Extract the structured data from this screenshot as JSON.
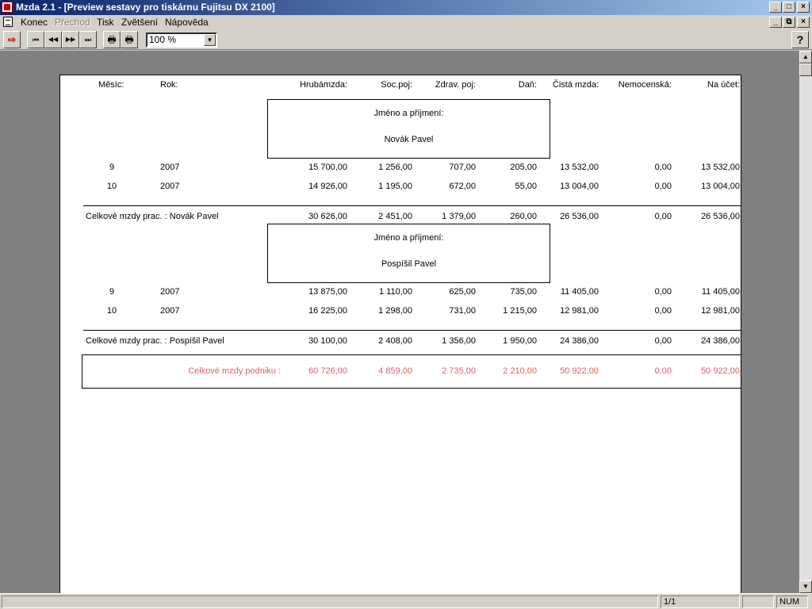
{
  "window": {
    "title": "Mzda 2.1 - [Preview sestavy pro tiskárnu Fujitsu DX 2100]",
    "btn_minimize": "_",
    "btn_maximize": "□",
    "btn_close": "×",
    "btn_restore": "⧉"
  },
  "menu": {
    "items": [
      "Konec",
      "Přechod",
      "Tisk",
      "Zvětšení",
      "Nápověda"
    ]
  },
  "toolbar": {
    "exit_glyph": "⇨",
    "first_glyph": "⏮",
    "prev_glyph": "◀◀",
    "next_glyph": "▶▶",
    "last_glyph": "⏭",
    "print_glyph": "🖶",
    "print_setup_glyph": "🖶",
    "help_glyph": "?",
    "zoom_value": "100 %",
    "dropdown_glyph": "▼"
  },
  "report": {
    "headers": [
      "Měsíc:",
      "Rok:",
      "Hrubámzda:",
      "Soc.poj:",
      "Zdrav. poj:",
      "Daň:",
      "Čistá mzda:",
      "Nemocenská:",
      "Na účet:"
    ],
    "name_label": "Jméno a příjmení:",
    "employees": [
      {
        "name": "Novák Pavel",
        "rows": [
          [
            "9",
            "2007",
            "15 700,00",
            "1 256,00",
            "707,00",
            "205,00",
            "13 532,00",
            "0,00",
            "13 532,00"
          ],
          [
            "10",
            "2007",
            "14 926,00",
            "1 195,00",
            "672,00",
            "55,00",
            "13 004,00",
            "0,00",
            "13 004,00"
          ]
        ],
        "total_label": "Celkové mzdy prac. : Novák Pavel",
        "totals": [
          "30 626,00",
          "2 451,00",
          "1 379,00",
          "260,00",
          "26 536,00",
          "0,00",
          "26 536,00"
        ]
      },
      {
        "name": "Pospíšil Pavel",
        "rows": [
          [
            "9",
            "2007",
            "13 875,00",
            "1 110,00",
            "625,00",
            "735,00",
            "11 405,00",
            "0,00",
            "11 405,00"
          ],
          [
            "10",
            "2007",
            "16 225,00",
            "1 298,00",
            "731,00",
            "1 215,00",
            "12 981,00",
            "0,00",
            "12 981,00"
          ]
        ],
        "total_label": "Celkové mzdy prac. : Pospíšil Pavel",
        "totals": [
          "30 100,00",
          "2 408,00",
          "1 356,00",
          "1 950,00",
          "24 386,00",
          "0,00",
          "24 386,00"
        ]
      }
    ],
    "grand_label": "Celkové mzdy podniku :",
    "grand_totals": [
      "60 726,00",
      "4 859,00",
      "2 735,00",
      "2 210,00",
      "50 922,00",
      "0,00",
      "50 922,00"
    ]
  },
  "scrollbar": {
    "up_glyph": "▲",
    "down_glyph": "▼"
  },
  "status": {
    "page": "1/1",
    "num": "NUM"
  },
  "colors": {
    "grand_total": "#e06060",
    "title_start": "#0a246a",
    "title_end": "#a6caf0"
  }
}
